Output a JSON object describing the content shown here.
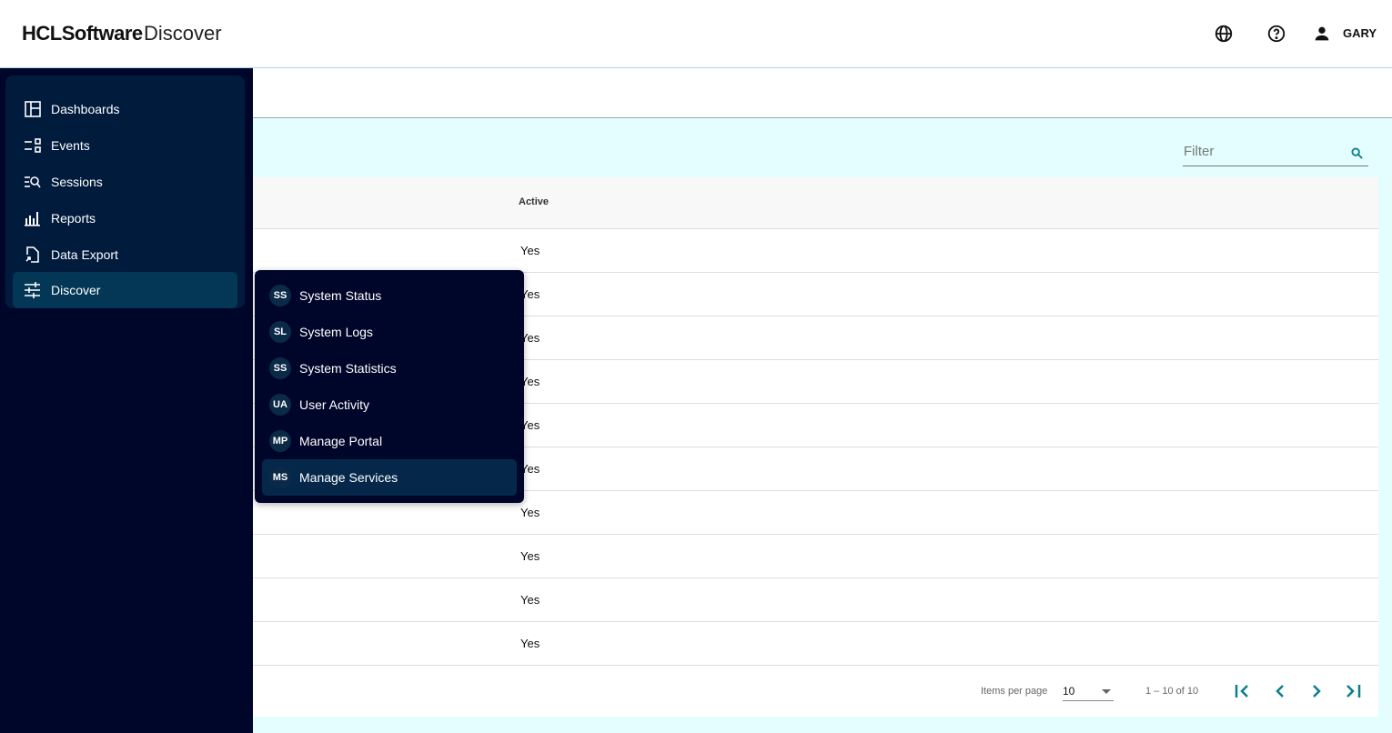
{
  "header": {
    "brand": "HCLSoftware",
    "product": "Discover",
    "user": "GARY"
  },
  "sidebar": {
    "items": [
      {
        "label": "Dashboards"
      },
      {
        "label": "Events"
      },
      {
        "label": "Sessions"
      },
      {
        "label": "Reports"
      },
      {
        "label": "Data Export"
      },
      {
        "label": "Discover"
      }
    ]
  },
  "menu": {
    "items": [
      {
        "badge": "SS",
        "label": "System Status"
      },
      {
        "badge": "SL",
        "label": "System Logs"
      },
      {
        "badge": "SS",
        "label": "System Statistics"
      },
      {
        "badge": "UA",
        "label": "User Activity"
      },
      {
        "badge": "MP",
        "label": "Manage Portal"
      },
      {
        "badge": "MS",
        "label": "Manage Services"
      }
    ]
  },
  "filter": {
    "placeholder": "Filter"
  },
  "table": {
    "column": "Active",
    "rows": [
      "Yes",
      "Yes",
      "Yes",
      "Yes",
      "Yes",
      "Yes",
      "Yes",
      "Yes",
      "Yes",
      "Yes"
    ]
  },
  "pager": {
    "label": "Items per page",
    "size": "10",
    "range": "1 – 10 of 10"
  },
  "colors": {
    "accent": "#0a7f8c",
    "sidebar": "#00052a"
  }
}
